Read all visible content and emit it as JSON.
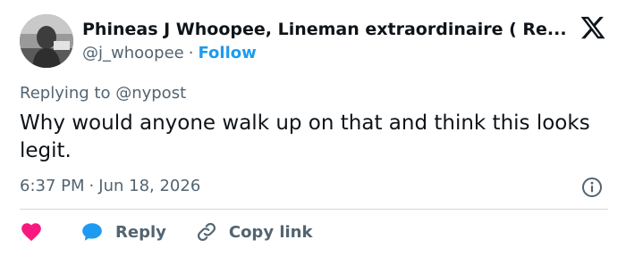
{
  "author": {
    "display_name": "Phineas J Whoopee, Lineman extraordinaire ( Re...",
    "handle": "@j_whoopee",
    "separator": "·",
    "follow_label": "Follow"
  },
  "tweet": {
    "replying_to": "Replying to @nypost",
    "text": "Why would anyone walk up on that and think this looks legit.",
    "time": "6:37 PM",
    "separator": "·",
    "date": "Jun 18, 2026"
  },
  "actions": {
    "reply_label": "Reply",
    "copy_link_label": "Copy link"
  },
  "icons": {
    "brand": "x-logo-icon",
    "info": "info-icon",
    "like": "heart-icon",
    "reply": "speech-bubble-icon",
    "copy": "link-icon"
  },
  "colors": {
    "text_primary": "#0f1419",
    "text_secondary": "#536471",
    "link": "#1d9bf0",
    "like": "#f91880",
    "reply": "#1d9bf0",
    "divider": "#cfd9de"
  }
}
